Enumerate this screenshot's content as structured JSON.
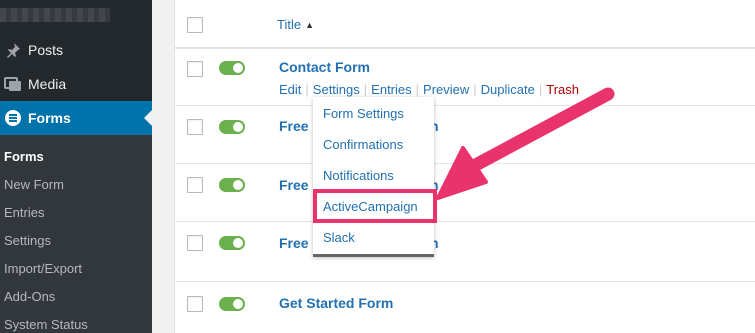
{
  "sidebar": {
    "items": [
      {
        "label": "Posts",
        "icon": "pushpin-icon"
      },
      {
        "label": "Media",
        "icon": "media-icon"
      },
      {
        "label": "Forms",
        "icon": "forms-icon"
      }
    ],
    "submenu": [
      "Forms",
      "New Form",
      "Entries",
      "Settings",
      "Import/Export",
      "Add-Ons",
      "System Status"
    ]
  },
  "table": {
    "header_title": "Title",
    "sort_glyph": "▲",
    "rows": [
      {
        "title": "Contact Form"
      },
      {
        "title": "Free"
      },
      {
        "title": "Free"
      },
      {
        "title": "Free"
      },
      {
        "title": "Get Started Form"
      }
    ],
    "row_title_tails": [
      "n",
      "n",
      "n"
    ],
    "row_actions": [
      "Edit",
      "Settings",
      "Entries",
      "Preview",
      "Duplicate",
      "Trash"
    ]
  },
  "dropdown": {
    "items": [
      "Form Settings",
      "Confirmations",
      "Notifications",
      "ActiveCampaign",
      "Slack"
    ],
    "highlighted": "ActiveCampaign"
  },
  "colors": {
    "sidebar_bg": "#23282d",
    "active_blue": "#0073aa",
    "toggle_green": "#6ab04c",
    "link_blue": "#2271b1",
    "trash_red": "#a00",
    "annotation_pink": "#e8336d"
  }
}
